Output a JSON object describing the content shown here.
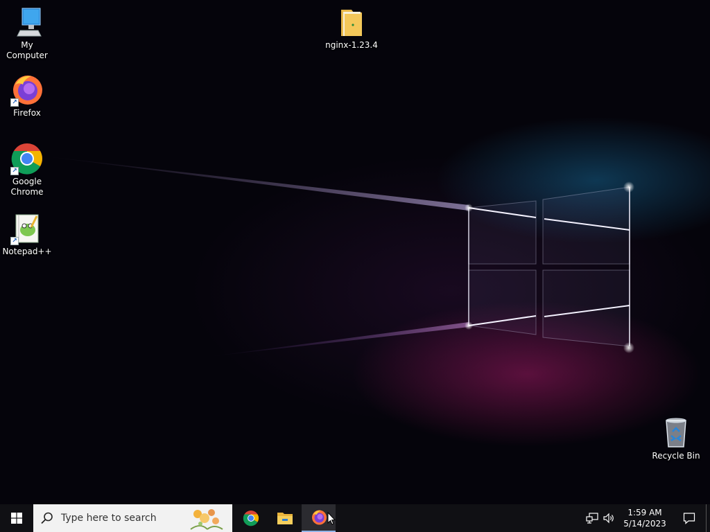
{
  "desktop": {
    "icons": [
      {
        "id": "my-computer",
        "label": "My Computer",
        "icon": "monitor-icon"
      },
      {
        "id": "firefox",
        "label": "Firefox",
        "icon": "firefox-icon"
      },
      {
        "id": "chrome",
        "label": "Google Chrome",
        "icon": "chrome-icon"
      },
      {
        "id": "notepadpp",
        "label": "Notepad++",
        "icon": "notepadpp-icon"
      },
      {
        "id": "nginx",
        "label": "nginx-1.23.4",
        "icon": "folder-icon"
      },
      {
        "id": "recycle-bin",
        "label": "Recycle Bin",
        "icon": "recycle-bin-icon"
      }
    ]
  },
  "taskbar": {
    "search_placeholder": "Type here to search",
    "pinned": [
      {
        "id": "chrome",
        "icon": "chrome-icon",
        "active": false
      },
      {
        "id": "file-explorer",
        "icon": "folder-icon",
        "active": false
      },
      {
        "id": "firefox",
        "icon": "firefox-icon",
        "active": true
      }
    ],
    "tray": {
      "time": "1:59 AM",
      "date": "5/14/2023"
    }
  },
  "colors": {
    "taskbar": "#101014",
    "search_bg": "#f2f2f2",
    "folder": "#f4c85a",
    "windows_blue": "#00a4ef"
  }
}
